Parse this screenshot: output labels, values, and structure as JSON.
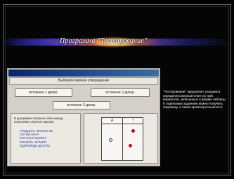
{
  "slide": {
    "title": "Программа \"Тестирование\"",
    "description": "\"Тестирование\" предлагает учащимся определить верный ответ из трёх вариантов, записанных в форме таблицы.\nК отдельным заданиям можно получить подсказку, а также промежуточный итог."
  },
  "app": {
    "header": "Выберите верное утверждение",
    "options": [
      "истинное 1 диагр.",
      "истинное 2 диагр.",
      "истинное 3 диагр."
    ],
    "question": {
      "text": "В диаграмме показана связь между понятиями, отметьте верную:",
      "sub": "ТРЕДЦАТЬ ЧЕТЫРЕ ЛЕ\nСОТНИ ЗНАЛ\nЕГО ЗАСТАВЛЯЮТ\nПЛАТИТЬ ЧЕТЫРЕ\nЕДИНОЖДЫ ДЕСЯТЬ"
    },
    "diagram": {
      "columns": [
        "А",
        "Т"
      ]
    }
  },
  "colors": {
    "beam_center": "#fff2c0",
    "beam_warm": "#ff9a2a",
    "beam_cool": "#3b2fb0",
    "window_face": "#d4d0c8",
    "dot_red": "#c0101a"
  }
}
